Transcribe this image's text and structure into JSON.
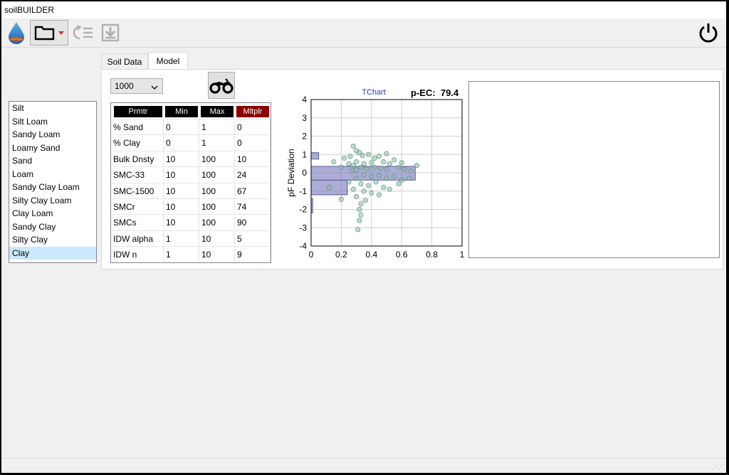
{
  "window": {
    "title": "soilBUILDER"
  },
  "toolbar": {
    "logo_icon": "water-drop-earth-icon",
    "open_icon": "folder-icon",
    "undo_icon": "undo-list-icon",
    "save_icon": "download-box-icon",
    "power_icon": "power-icon"
  },
  "soil_list": {
    "items": [
      "Silt",
      "Silt Loam",
      "Sandy Loam",
      "Loamy Sand",
      "Sand",
      "Loam",
      "Sandy Clay Loam",
      "Silty Clay Loam",
      "Clay Loam",
      "Sandy Clay",
      "Silty Clay",
      "Clay"
    ],
    "selected": "Clay"
  },
  "tabs": [
    {
      "label": "Soil Data"
    },
    {
      "label": "Model"
    }
  ],
  "model": {
    "iterations": "1000",
    "run_icon": "motorcycle-icon",
    "table": {
      "headers": [
        "Prmtr",
        "Min",
        "Max",
        "Mltplr"
      ],
      "header_colors": [
        "#000000",
        "#000000",
        "#000000",
        "#8b0000"
      ],
      "rows": [
        [
          "% Sand",
          "0",
          "1",
          "0"
        ],
        [
          "% Clay",
          "0",
          "1",
          "0"
        ],
        [
          "Bulk Dnsty",
          "10",
          "100",
          "10"
        ],
        [
          "SMC-33",
          "10",
          "100",
          "24"
        ],
        [
          "SMC-1500",
          "10",
          "100",
          "67"
        ],
        [
          "SMCr",
          "10",
          "100",
          "74"
        ],
        [
          "SMCs",
          "10",
          "100",
          "90"
        ],
        [
          "IDW alpha",
          "1",
          "10",
          "5"
        ],
        [
          "IDW n",
          "1",
          "10",
          "9"
        ]
      ]
    },
    "pec_label": "p-EC:",
    "pec_value": "79.4"
  },
  "chart_data": {
    "type": "scatter",
    "title": "TChart",
    "xlabel": "",
    "ylabel": "pF Deviation",
    "xlim": [
      0,
      1
    ],
    "ylim": [
      -4,
      4
    ],
    "x_ticks": [
      "0",
      "0.2",
      "0.4",
      "0.6",
      "0.8",
      "1"
    ],
    "y_ticks": [
      "4",
      "3",
      "2",
      "1",
      "0",
      "-1",
      "-2",
      "-3",
      "-4"
    ],
    "grid": true,
    "colors": {
      "points": "#7fc4a4",
      "bars": "#8080c0",
      "title": "#1f3fbf"
    },
    "histogram_bars": [
      {
        "y0": 0.75,
        "y1": 1.1,
        "x_extent": 0.05
      },
      {
        "y0": -0.4,
        "y1": 0.35,
        "x_extent": 0.69
      },
      {
        "y0": -1.2,
        "y1": -0.4,
        "x_extent": 0.24
      },
      {
        "y0": -2.2,
        "y1": -1.4,
        "x_extent": 0.01
      }
    ],
    "points": [
      [
        0.28,
        1.45
      ],
      [
        0.3,
        1.2
      ],
      [
        0.32,
        1.1
      ],
      [
        0.26,
        0.9
      ],
      [
        0.34,
        0.95
      ],
      [
        0.38,
        1.0
      ],
      [
        0.42,
        0.8
      ],
      [
        0.5,
        1.05
      ],
      [
        0.22,
        0.8
      ],
      [
        0.45,
        0.9
      ],
      [
        0.3,
        0.6
      ],
      [
        0.35,
        0.5
      ],
      [
        0.4,
        0.55
      ],
      [
        0.28,
        0.4
      ],
      [
        0.48,
        0.6
      ],
      [
        0.52,
        0.5
      ],
      [
        0.55,
        0.7
      ],
      [
        0.6,
        0.55
      ],
      [
        0.25,
        0.5
      ],
      [
        0.33,
        0.3
      ],
      [
        0.37,
        0.2
      ],
      [
        0.42,
        0.3
      ],
      [
        0.46,
        0.25
      ],
      [
        0.3,
        0.15
      ],
      [
        0.5,
        0.2
      ],
      [
        0.58,
        0.3
      ],
      [
        0.62,
        0.2
      ],
      [
        0.66,
        0.1
      ],
      [
        0.2,
        0.3
      ],
      [
        0.27,
        0.1
      ],
      [
        0.35,
        -0.1
      ],
      [
        0.4,
        -0.2
      ],
      [
        0.45,
        -0.15
      ],
      [
        0.3,
        -0.3
      ],
      [
        0.5,
        -0.3
      ],
      [
        0.55,
        -0.2
      ],
      [
        0.6,
        -0.4
      ],
      [
        0.25,
        -0.5
      ],
      [
        0.33,
        -0.6
      ],
      [
        0.38,
        -0.7
      ],
      [
        0.43,
        -0.5
      ],
      [
        0.48,
        -0.8
      ],
      [
        0.28,
        -0.9
      ],
      [
        0.35,
        -1.0
      ],
      [
        0.4,
        -1.1
      ],
      [
        0.45,
        -1.2
      ],
      [
        0.3,
        -1.3
      ],
      [
        0.36,
        -1.5
      ],
      [
        0.33,
        -1.7
      ],
      [
        0.32,
        -2.0
      ],
      [
        0.33,
        -2.3
      ],
      [
        0.32,
        -2.6
      ],
      [
        0.31,
        -3.1
      ],
      [
        0.2,
        -1.45
      ],
      [
        0.52,
        -0.9
      ],
      [
        0.58,
        -0.6
      ],
      [
        0.65,
        -0.3
      ],
      [
        0.15,
        0.6
      ],
      [
        0.12,
        -0.8
      ],
      [
        0.7,
        0.4
      ]
    ]
  }
}
